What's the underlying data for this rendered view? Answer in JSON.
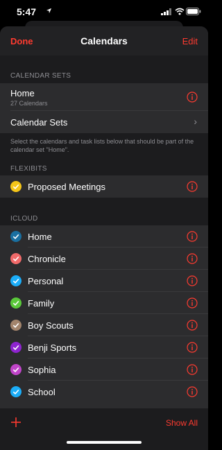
{
  "status": {
    "time": "5:47"
  },
  "nav": {
    "done": "Done",
    "title": "Calendars",
    "edit": "Edit"
  },
  "calendar_sets": {
    "header": "CALENDAR SETS",
    "home": {
      "title": "Home",
      "subtitle": "27 Calendars"
    },
    "sets_row": "Calendar Sets",
    "footnote": "Select the calendars and task lists below that should be part of the calendar set \"Home\"."
  },
  "flexibits": {
    "header": "FLEXIBITS",
    "items": [
      {
        "label": "Proposed Meetings",
        "color": "#f5c518"
      }
    ]
  },
  "icloud": {
    "header": "ICLOUD",
    "items": [
      {
        "label": "Home",
        "color": "#1a6fa0"
      },
      {
        "label": "Chronicle",
        "color": "#f06a6a"
      },
      {
        "label": "Personal",
        "color": "#1badf8"
      },
      {
        "label": "Family",
        "color": "#5ac83a"
      },
      {
        "label": "Boy Scouts",
        "color": "#a2846c"
      },
      {
        "label": "Benji Sports",
        "color": "#8e24cf"
      },
      {
        "label": "Sophia",
        "color": "#c045c9"
      },
      {
        "label": "School",
        "color": "#1badf8"
      }
    ]
  },
  "toolbar": {
    "show_all": "Show All"
  },
  "colors": {
    "accent": "#ff3b30",
    "row_bg": "#2c2c2e",
    "sheet_bg": "#1c1c1e"
  }
}
